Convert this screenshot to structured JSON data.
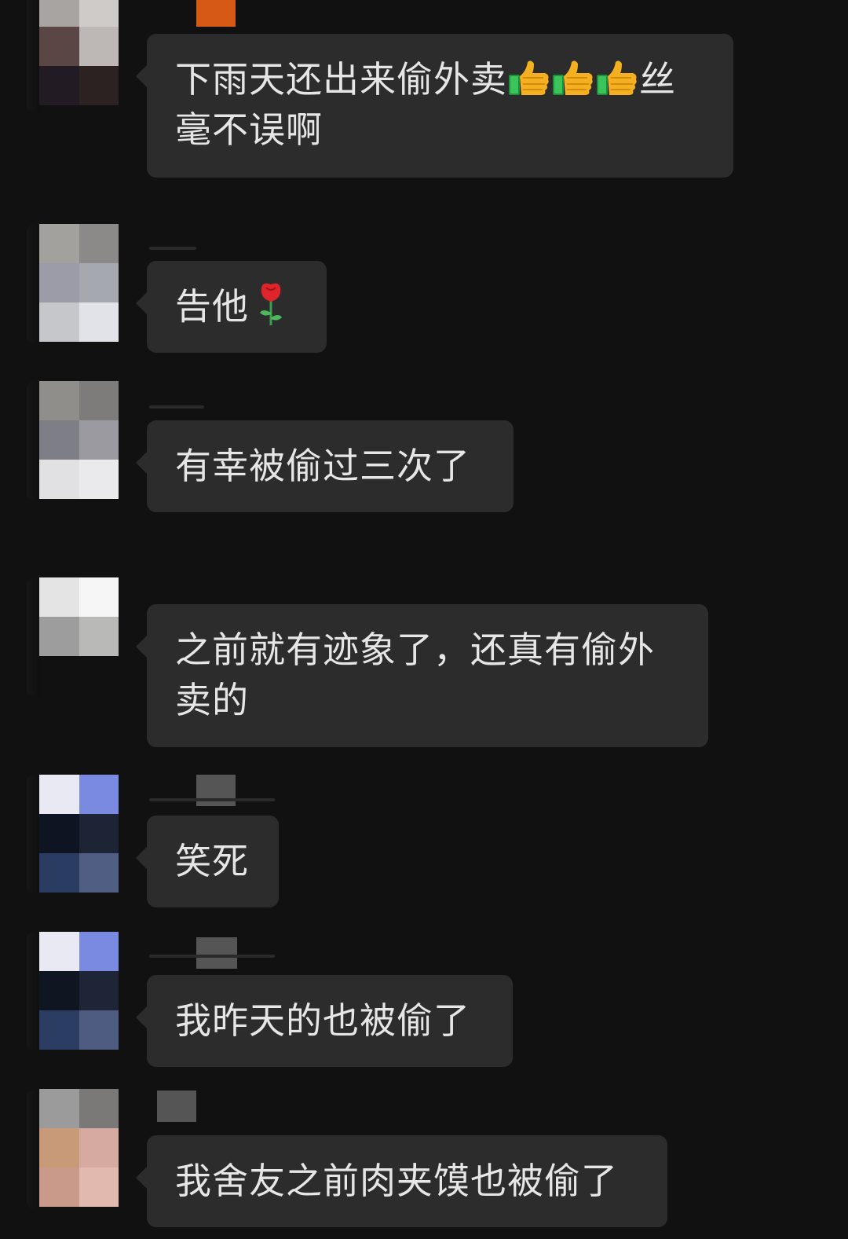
{
  "messages": [
    {
      "id": "m1",
      "text_a": "下雨天还出来偷外卖",
      "emoji": [
        "thumbs-up-icon",
        "thumbs-up-icon",
        "thumbs-up-icon"
      ],
      "text_b": "丝毫不误啊"
    },
    {
      "id": "m2",
      "text": "告他",
      "emoji": "rose-icon"
    },
    {
      "id": "m3",
      "text": "有幸被偷过三次了"
    },
    {
      "id": "m4",
      "text": "之前就有迹象了，还真有偷外卖的"
    },
    {
      "id": "m5",
      "text": "笑死"
    },
    {
      "id": "m6",
      "text": "我昨天的也被偷了"
    },
    {
      "id": "m7",
      "text": "我舍友之前肉夹馍也被偷了"
    }
  ],
  "colors": {
    "background": "#111111",
    "bubble": "#2c2c2c",
    "text": "#e6e6e6"
  }
}
